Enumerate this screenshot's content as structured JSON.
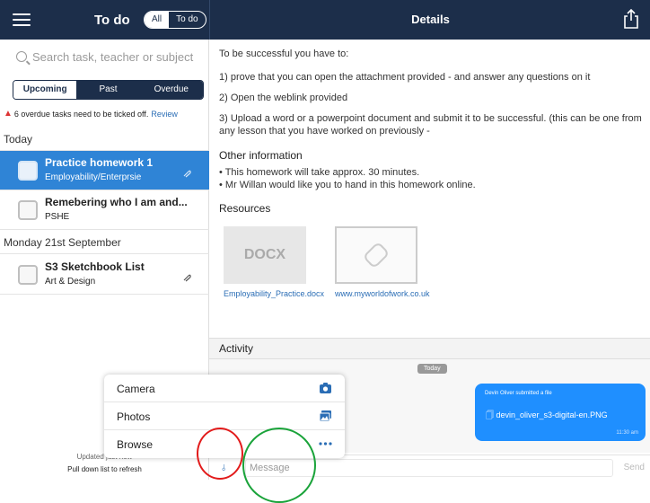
{
  "left_header": {
    "title": "To do",
    "filter_all": "All",
    "filter_todo": "To do"
  },
  "right_header": {
    "title": "Details"
  },
  "search": {
    "placeholder": "Search task, teacher or subject"
  },
  "tabs": [
    {
      "label": "Upcoming",
      "selected": true
    },
    {
      "label": "Past",
      "selected": false
    },
    {
      "label": "Overdue",
      "selected": false
    }
  ],
  "overdue_notice": {
    "text": "6 overdue tasks need to be ticked off.",
    "link": "Review"
  },
  "groups": [
    {
      "header": "Today",
      "tasks": [
        {
          "title": "Practice homework 1",
          "subject": "Employability/Enterprsie",
          "selected": true,
          "has_attachment": true
        },
        {
          "title": "Remebering who I am and...",
          "subject": "PSHE",
          "selected": false,
          "has_attachment": false
        }
      ]
    },
    {
      "header": "Monday 21st September",
      "tasks": [
        {
          "title": "S3 Sketchbook List",
          "subject": "Art & Design",
          "selected": false,
          "has_attachment": true
        }
      ]
    }
  ],
  "refresh": {
    "updated": "Updated just now",
    "pull": "Pull down list to refresh"
  },
  "details": {
    "intro": "To be successful you have to:",
    "step1": "1) prove that you can open the attachment provided - and answer any questions on it",
    "step2": "2) Open the weblink provided",
    "step3": "3) Upload a word or a powerpoint document and submit it to be successful. (this can be one from any lesson that you have worked on previously -",
    "other_header": "Other information",
    "other1": "• This homework will take approx. 30 minutes.",
    "other2": "• Mr Willan would like you to hand in this homework online.",
    "resources_header": "Resources",
    "resources": [
      {
        "thumb": "DOCX",
        "caption": "Employability_Practice.docx"
      },
      {
        "thumb": "",
        "caption": "www.myworldofwork.co.uk"
      }
    ]
  },
  "activity": {
    "header": "Activity",
    "date_pill": "Today",
    "bubble_line1": "Devin Oliver submitted a file",
    "bubble_file": "devin_oliver_s3-digital-en.PNG",
    "bubble_time": "11:30 am"
  },
  "message": {
    "placeholder": "Message",
    "send": "Send"
  },
  "attach_menu": [
    {
      "label": "Camera",
      "icon": "camera-icon"
    },
    {
      "label": "Photos",
      "icon": "photos-icon"
    },
    {
      "label": "Browse",
      "icon": "more-dots-icon"
    }
  ],
  "colors": {
    "header_bg": "#1c2e4a",
    "selected_row": "#2f84d6",
    "accent_blue": "#2a6db5",
    "bubble_blue": "#1f8fff",
    "annotation_red": "#e21b1b",
    "annotation_green": "#1aa33a"
  }
}
